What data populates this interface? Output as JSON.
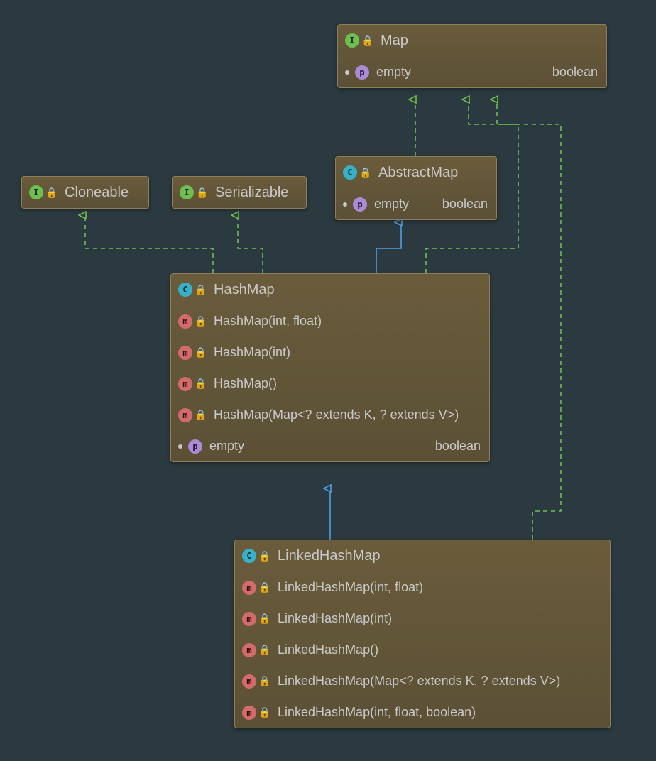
{
  "icons": {
    "interface": "I",
    "class": "C",
    "method": "m",
    "property": "p"
  },
  "colors": {
    "background": "#2b3a40",
    "box_fill": "#5b5036",
    "box_border": "#8e7f5a",
    "implements_line": "#6fbf4f",
    "extends_line": "#4f9fe3",
    "interface_badge": "#6fbf4f",
    "class_badge": "#37b1c8",
    "method_badge": "#d46b6b",
    "property_badge": "#a98bd6"
  },
  "edges": [
    {
      "from": "AbstractMap",
      "to": "Map",
      "kind": "implements"
    },
    {
      "from": "HashMap",
      "to": "AbstractMap",
      "kind": "extends"
    },
    {
      "from": "HashMap",
      "to": "Map",
      "kind": "implements"
    },
    {
      "from": "HashMap",
      "to": "Serializable",
      "kind": "implements"
    },
    {
      "from": "HashMap",
      "to": "Cloneable",
      "kind": "implements"
    },
    {
      "from": "LinkedHashMap",
      "to": "HashMap",
      "kind": "extends"
    },
    {
      "from": "LinkedHashMap",
      "to": "Map",
      "kind": "implements"
    }
  ],
  "nodes": {
    "map": {
      "name": "Map",
      "kind": "interface",
      "props": [
        {
          "name": "empty",
          "type": "boolean"
        }
      ]
    },
    "abstractmap": {
      "name": "AbstractMap",
      "kind": "abstract-class",
      "props": [
        {
          "name": "empty",
          "type": "boolean"
        }
      ]
    },
    "cloneable": {
      "name": "Cloneable",
      "kind": "interface"
    },
    "serializable": {
      "name": "Serializable",
      "kind": "interface"
    },
    "hashmap": {
      "name": "HashMap",
      "kind": "class",
      "methods": [
        "HashMap(int, float)",
        "HashMap(int)",
        "HashMap()",
        "HashMap(Map<? extends K, ? extends V>)"
      ],
      "props": [
        {
          "name": "empty",
          "type": "boolean"
        }
      ]
    },
    "linkedhashmap": {
      "name": "LinkedHashMap",
      "kind": "class",
      "methods": [
        "LinkedHashMap(int, float)",
        "LinkedHashMap(int)",
        "LinkedHashMap()",
        "LinkedHashMap(Map<? extends K, ? extends V>)",
        "LinkedHashMap(int, float, boolean)"
      ]
    }
  }
}
